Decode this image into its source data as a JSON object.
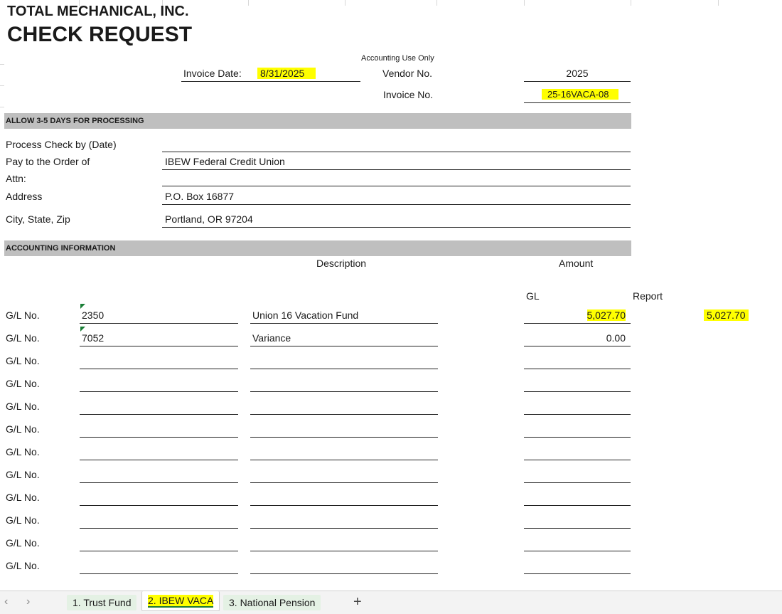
{
  "header": {
    "company": "TOTAL MECHANICAL, INC.",
    "title": "CHECK REQUEST",
    "accounting_use_only": "Accounting Use Only"
  },
  "invoice_date": {
    "label": "Invoice Date:",
    "value": "8/31/2025"
  },
  "vendor_no": {
    "label": "Vendor No.",
    "value": "2025"
  },
  "invoice_no": {
    "label": "Invoice No.",
    "value": "25-16VACA-08"
  },
  "processing_band": "ALLOW 3-5 DAYS FOR PROCESSING",
  "payee": {
    "process_by_label": "Process Check by (Date)",
    "process_by_value": "",
    "pay_to_label": "Pay to the Order of",
    "pay_to_value": "IBEW Federal Credit Union",
    "attn_label": "Attn:",
    "attn_value": "",
    "address_label": "Address",
    "address_value": "P.O. Box 16877",
    "city_label": "City, State, Zip",
    "city_value": "Portland, OR 97204"
  },
  "accounting_band": "ACCOUNTING INFORMATION",
  "columns": {
    "description": "Description",
    "amount": "Amount",
    "gl": "GL",
    "report": "Report"
  },
  "gl_rows": [
    {
      "label": "G/L No.",
      "account": "2350",
      "description": "Union 16 Vacation Fund",
      "amount": "5,027.70",
      "report": "5,027.70"
    },
    {
      "label": "G/L No.",
      "account": "7052",
      "description": "Variance",
      "amount": "0.00",
      "report": ""
    },
    {
      "label": "G/L No.",
      "account": "",
      "description": "",
      "amount": "",
      "report": ""
    },
    {
      "label": "G/L No.",
      "account": "",
      "description": "",
      "amount": "",
      "report": ""
    },
    {
      "label": "G/L No.",
      "account": "",
      "description": "",
      "amount": "",
      "report": ""
    },
    {
      "label": "G/L No.",
      "account": "",
      "description": "",
      "amount": "",
      "report": ""
    },
    {
      "label": "G/L No.",
      "account": "",
      "description": "",
      "amount": "",
      "report": ""
    },
    {
      "label": "G/L No.",
      "account": "",
      "description": "",
      "amount": "",
      "report": ""
    },
    {
      "label": "G/L No.",
      "account": "",
      "description": "",
      "amount": "",
      "report": ""
    },
    {
      "label": "G/L No.",
      "account": "",
      "description": "",
      "amount": "",
      "report": ""
    },
    {
      "label": "G/L No.",
      "account": "",
      "description": "",
      "amount": "",
      "report": ""
    },
    {
      "label": "G/L No.",
      "account": "",
      "description": "",
      "amount": "",
      "report": ""
    },
    {
      "label": "G/L No.",
      "account": "",
      "description": "",
      "amount": "",
      "report": ""
    }
  ],
  "sheet_tabs": [
    {
      "label": "1. Trust Fund",
      "active": false
    },
    {
      "label": "2. IBEW VACA",
      "active": true
    },
    {
      "label": "3. National Pension",
      "active": false
    }
  ],
  "tabbar": {
    "prev_icon": "chevron-left-icon",
    "next_icon": "chevron-right-icon",
    "add_icon": "plus-icon",
    "add_glyph": "+"
  },
  "colors": {
    "band_gray": "#bfbfbf",
    "highlight": "#ffff00",
    "active_tab_underline": "#1e7b34",
    "error_triangle": "#1a7f37"
  }
}
